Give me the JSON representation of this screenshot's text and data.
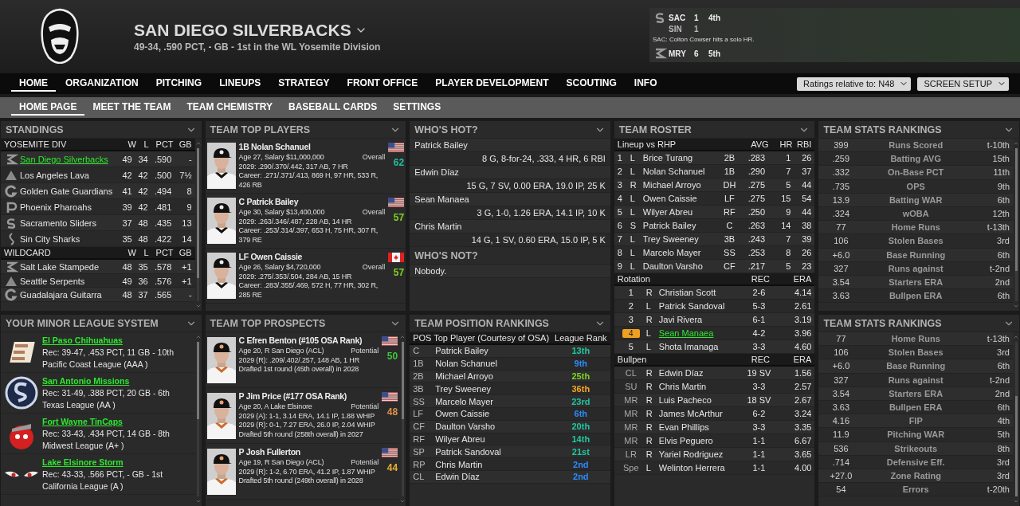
{
  "header": {
    "team_name": "SAN DIEGO SILVERBACKS",
    "record": "49-34, .590 PCT, - GB - 1st in the WL Yosemite Division"
  },
  "scoreboard": [
    {
      "away": "SAC",
      "away_score": "1",
      "inning": "4th",
      "home": "SIN",
      "home_score": "1",
      "note": "SAC: Colton Cowser hits a solo HR."
    },
    {
      "away": "MRY",
      "away_score": "6",
      "inning": "5th"
    }
  ],
  "nav": {
    "tabs": [
      {
        "label": "HOME",
        "selected": true
      },
      {
        "label": "ORGANIZATION",
        "selected": false
      },
      {
        "label": "PITCHING",
        "selected": false
      },
      {
        "label": "LINEUPS",
        "selected": false
      },
      {
        "label": "STRATEGY",
        "selected": false
      },
      {
        "label": "FRONT OFFICE",
        "selected": false
      },
      {
        "label": "PLAYER DEVELOPMENT",
        "selected": false
      },
      {
        "label": "SCOUTING",
        "selected": false
      },
      {
        "label": "INFO",
        "selected": false
      }
    ],
    "dropdowns": [
      "Ratings relative to: N48",
      "SCREEN SETUP"
    ]
  },
  "subnav": [
    {
      "label": "HOME PAGE",
      "selected": true
    },
    {
      "label": "MEET THE TEAM",
      "selected": false
    },
    {
      "label": "TEAM CHEMISTRY",
      "selected": false
    },
    {
      "label": "BASEBALL CARDS",
      "selected": false
    },
    {
      "label": "SETTINGS",
      "selected": false
    }
  ],
  "standings": {
    "title": "STANDINGS",
    "groups": [
      {
        "name": "YOSEMITE DIV",
        "columns": [
          "W",
          "L",
          "PCT",
          "GB"
        ],
        "rows": [
          {
            "team": "San Diego Silverbacks",
            "w": "49",
            "l": "34",
            "pct": ".590",
            "gb": "-",
            "selected": true
          },
          {
            "team": "Los Angeles Lava",
            "w": "42",
            "l": "42",
            "pct": ".500",
            "gb": "7½",
            "selected": false
          },
          {
            "team": "Golden Gate Guardians",
            "w": "41",
            "l": "42",
            "pct": ".494",
            "gb": "8",
            "selected": false
          },
          {
            "team": "Phoenix Pharoahs",
            "w": "39",
            "l": "42",
            "pct": ".481",
            "gb": "9",
            "selected": false
          },
          {
            "team": "Sacramento Sliders",
            "w": "37",
            "l": "48",
            "pct": ".435",
            "gb": "13",
            "selected": false
          },
          {
            "team": "Sin City Sharks",
            "w": "35",
            "l": "48",
            "pct": ".422",
            "gb": "14",
            "selected": false
          }
        ]
      },
      {
        "name": "WILDCARD",
        "columns": [
          "W",
          "L",
          "PCT",
          "GB"
        ],
        "rows": [
          {
            "team": "Salt Lake Stampede",
            "w": "48",
            "l": "35",
            "pct": ".578",
            "gb": "+1",
            "selected": false
          },
          {
            "team": "Seattle Serpents",
            "w": "49",
            "l": "36",
            "pct": ".576",
            "gb": "+1",
            "selected": false
          },
          {
            "team": "Guadalajara Guitarra",
            "w": "48",
            "l": "37",
            "pct": ".565",
            "gb": "-",
            "selected": false
          }
        ]
      }
    ]
  },
  "top_players": {
    "title": "TEAM TOP PLAYERS",
    "players": [
      {
        "name": "1B Nolan Schanuel",
        "kind": "us",
        "info": "Age 27, Salary $11,000,000",
        "rating_label": "Overall",
        "rating": "62",
        "color": "#1fbfa0",
        "season": "2029: .290/.370/.442, 317 AB, 7 HR",
        "career": "Career: .271/.371/.413, 869 H, 97 HR, 533 R, 426 RB"
      },
      {
        "name": "C Patrick Bailey",
        "kind": "us",
        "info": "Age 30, Salary $13,400,000",
        "rating_label": "Overall",
        "rating": "57",
        "color": "#7ed321",
        "season": "2029: .263/.346/.487, 228 AB, 14 HR",
        "career": "Career: .253/.314/.397, 653 H, 75 HR, 307 R, 379 RE"
      },
      {
        "name": "LF Owen Caissie",
        "kind": "ca",
        "info": "Age 26, Salary $4,720,000",
        "rating_label": "Overall",
        "rating": "57",
        "color": "#7ed321",
        "season": "2029: .275/.353/.504, 284 AB, 15 HR",
        "career": "Career: .283/.355/.469, 572 H, 77 HR, 302 R, 285 RE"
      }
    ]
  },
  "whos_hot": {
    "title": "WHO'S HOT?",
    "players": [
      {
        "name": "Patrick Bailey",
        "line": "8 G, 8-for-24, .333, 4 HR, 6 RBI"
      },
      {
        "name": "Edwin Díaz",
        "line": "15 G, 7 SV, 0.00 ERA, 19.0 IP, 25 K"
      },
      {
        "name": "Sean Manaea",
        "line": "3 G, 1-0, 1.26 ERA, 14.1 IP, 10 K"
      },
      {
        "name": "Chris Martin",
        "line": "14 G, 1 SV, 0.60 ERA, 15.0 IP, 5 K"
      }
    ],
    "not_title": "WHO'S NOT?",
    "not_text": "Nobody."
  },
  "roster": {
    "title": "TEAM ROSTER",
    "lineup": {
      "label": "Lineup vs RHP",
      "columns": [
        "AVG",
        "HR",
        "RBI"
      ],
      "rows": [
        {
          "order": "1",
          "bats": "L",
          "name": "Brice Turang",
          "pos": "2B",
          "avg": ".283",
          "hr": "1",
          "rbi": "26"
        },
        {
          "order": "2",
          "bats": "L",
          "name": "Nolan Schanuel",
          "pos": "1B",
          "avg": ".290",
          "hr": "7",
          "rbi": "37"
        },
        {
          "order": "3",
          "bats": "R",
          "name": "Michael Arroyo",
          "pos": "DH",
          "avg": ".275",
          "hr": "5",
          "rbi": "44"
        },
        {
          "order": "4",
          "bats": "L",
          "name": "Owen Caissie",
          "pos": "LF",
          "avg": ".275",
          "hr": "15",
          "rbi": "54"
        },
        {
          "order": "5",
          "bats": "L",
          "name": "Wilyer Abreu",
          "pos": "RF",
          "avg": ".250",
          "hr": "9",
          "rbi": "44"
        },
        {
          "order": "6",
          "bats": "S",
          "name": "Patrick Bailey",
          "pos": "C",
          "avg": ".263",
          "hr": "14",
          "rbi": "38"
        },
        {
          "order": "7",
          "bats": "L",
          "name": "Trey Sweeney",
          "pos": "3B",
          "avg": ".243",
          "hr": "7",
          "rbi": "39"
        },
        {
          "order": "8",
          "bats": "L",
          "name": "Marcelo Mayer",
          "pos": "SS",
          "avg": ".253",
          "hr": "8",
          "rbi": "26"
        },
        {
          "order": "9",
          "bats": "L",
          "name": "Daulton Varsho",
          "pos": "CF",
          "avg": ".217",
          "hr": "5",
          "rbi": "23"
        }
      ]
    },
    "rotation": {
      "label": "Rotation",
      "columns": [
        "REC",
        "ERA"
      ],
      "rows": [
        {
          "order": "1",
          "throws": "R",
          "name": "Christian Scott",
          "rec": "2-6",
          "era": "4.14",
          "selected": false
        },
        {
          "order": "2",
          "throws": "L",
          "name": "Patrick Sandoval",
          "rec": "5-3",
          "era": "2.61",
          "selected": false
        },
        {
          "order": "3",
          "throws": "R",
          "name": "Javi Rivera",
          "rec": "6-1",
          "era": "3.19",
          "selected": false
        },
        {
          "order": "4",
          "throws": "L",
          "name": "Sean Manaea",
          "rec": "4-2",
          "era": "3.96",
          "selected": true
        },
        {
          "order": "5",
          "throws": "L",
          "name": "Shota Imanaga",
          "rec": "3-3",
          "era": "4.60",
          "selected": false
        }
      ]
    },
    "bullpen": {
      "label": "Bullpen",
      "columns": [
        "REC",
        "ERA"
      ],
      "rows": [
        {
          "role": "CL",
          "throws": "R",
          "name": "Edwin Díaz",
          "rec": "19 SV",
          "era": "1.56"
        },
        {
          "role": "SU",
          "throws": "R",
          "name": "Chris Martin",
          "rec": "3-3",
          "era": "2.57"
        },
        {
          "role": "MR",
          "throws": "R",
          "name": "Luis Pacheco",
          "rec": "18 SV",
          "era": "2.67"
        },
        {
          "role": "MR",
          "throws": "R",
          "name": "James McArthur",
          "rec": "6-2",
          "era": "3.24"
        },
        {
          "role": "MR",
          "throws": "R",
          "name": "Evan Phillips",
          "rec": "3-3",
          "era": "3.35"
        },
        {
          "role": "MR",
          "throws": "R",
          "name": "Elvis Peguero",
          "rec": "1-1",
          "era": "6.67"
        },
        {
          "role": "LR",
          "throws": "R",
          "name": "Yariel Rodriguez",
          "rec": "1-1",
          "era": "3.65"
        },
        {
          "role": "Spe",
          "throws": "L",
          "name": "Welinton Herrera",
          "rec": "1-1",
          "era": "4.00"
        }
      ]
    }
  },
  "stats_rankings": [
    {
      "title": "TEAM STATS RANKINGS",
      "rows": [
        {
          "value": "399",
          "stat": "Runs Scored",
          "rank": "t-10th"
        },
        {
          "value": ".259",
          "stat": "Batting AVG",
          "rank": "15th"
        },
        {
          "value": ".332",
          "stat": "On-Base PCT",
          "rank": "11th"
        },
        {
          "value": ".735",
          "stat": "OPS",
          "rank": "9th"
        },
        {
          "value": "13.9",
          "stat": "Batting WAR",
          "rank": "6th"
        },
        {
          "value": ".324",
          "stat": "wOBA",
          "rank": "12th"
        },
        {
          "value": "77",
          "stat": "Home Runs",
          "rank": "t-13th"
        },
        {
          "value": "106",
          "stat": "Stolen Bases",
          "rank": "3rd"
        },
        {
          "value": "+6.0",
          "stat": "Base Running",
          "rank": "6th"
        },
        {
          "value": "327",
          "stat": "Runs against",
          "rank": "t-2nd"
        },
        {
          "value": "3.54",
          "stat": "Starters ERA",
          "rank": "2nd"
        },
        {
          "value": "3.63",
          "stat": "Bullpen ERA",
          "rank": "6th"
        }
      ]
    },
    {
      "title": "TEAM STATS RANKINGS",
      "rows": [
        {
          "value": "77",
          "stat": "Home Runs",
          "rank": "t-13th"
        },
        {
          "value": "106",
          "stat": "Stolen Bases",
          "rank": "3rd"
        },
        {
          "value": "+6.0",
          "stat": "Base Running",
          "rank": "6th"
        },
        {
          "value": "327",
          "stat": "Runs against",
          "rank": "t-2nd"
        },
        {
          "value": "3.54",
          "stat": "Starters ERA",
          "rank": "2nd"
        },
        {
          "value": "3.63",
          "stat": "Bullpen ERA",
          "rank": "6th"
        },
        {
          "value": "4.16",
          "stat": "FIP",
          "rank": "4th"
        },
        {
          "value": "11.9",
          "stat": "Pitching WAR",
          "rank": "5th"
        },
        {
          "value": "536",
          "stat": "Strikeouts",
          "rank": "8th"
        },
        {
          "value": ".714",
          "stat": "Defensive Eff.",
          "rank": "3rd"
        },
        {
          "value": "+27.0",
          "stat": "Zone Rating",
          "rank": "3rd"
        },
        {
          "value": "54",
          "stat": "Errors",
          "rank": "t-20th"
        }
      ]
    }
  ],
  "minor_leagues": {
    "title": "YOUR MINOR LEAGUE SYSTEM",
    "teams": [
      {
        "name": "El Paso Chihuahuas",
        "record": "Rec: 39-47, .453 PCT, 11 GB - 10th",
        "league": "Pacific Coast League (AAA )"
      },
      {
        "name": "San Antonio Missions",
        "record": "Rec: 31-49, .388 PCT, 20 GB - 6th",
        "league": "Texas League (AA )"
      },
      {
        "name": "Fort Wayne TinCaps",
        "record": "Rec: 33-43, .434 PCT, 14 GB - 8th",
        "league": "Midwest League (A+ )"
      },
      {
        "name": "Lake Elsinore Storm",
        "record": "Rec: 43-33, .566 PCT, - GB - 1st",
        "league": "California League (A )"
      }
    ]
  },
  "top_prospects": {
    "title": "TEAM TOP PROSPECTS",
    "players": [
      {
        "name": "C Efren Benton (#105 OSA Rank)",
        "kind": "us",
        "info": "Age 20, R San Diego (ACL)",
        "rating_label": "Potential",
        "rating": "50",
        "color": "#3ec43e",
        "stats": [
          "2029 (R): .209/.402/.257, 148 AB, 1 HR"
        ],
        "drafted": "Drafted 1st round (45th overall) in 2028"
      },
      {
        "name": "P Jim Price (#177 OSA Rank)",
        "kind": "us",
        "info": "Age 20, A Lake Elsinore",
        "rating_label": "Potential",
        "rating": "48",
        "color": "#e0904a",
        "stats": [
          "2029 (A): 1-1, 3.14 ERA, 14.1 IP, 1.88 WHIP",
          "2029 (R): 0-1, 7.27 ERA, 26.0 IP, 2.04 WHIP"
        ],
        "drafted": "Drafted 5th round (258th overall) in 2027"
      },
      {
        "name": "P Josh Fullerton",
        "kind": "us",
        "info": "Age 19, R San Diego (ACL)",
        "rating_label": "Potential",
        "rating": "44",
        "color": "#e8b030",
        "stats": [
          "2029 (R): 1-2, 6.70 ERA, 41.2 IP, 1.87 WHIP"
        ],
        "drafted": "Drafted 5th round (249th overall) in 2028"
      }
    ]
  },
  "position_rankings": {
    "title": "TEAM POSITION RANKINGS",
    "columns": [
      "POS",
      "Top Player (Courtesy of OSA)",
      "League Rank"
    ],
    "rows": [
      {
        "pos": "C",
        "player": "Patrick Bailey",
        "rank": "13th",
        "color": "#1ec8a0"
      },
      {
        "pos": "1B",
        "player": "Nolan Schanuel",
        "rank": "9th",
        "color": "#2a8cff"
      },
      {
        "pos": "2B",
        "player": "Michael Arroyo",
        "rank": "25th",
        "color": "#7ed321"
      },
      {
        "pos": "3B",
        "player": "Trey Sweeney",
        "rank": "36th",
        "color": "#f5a623"
      },
      {
        "pos": "SS",
        "player": "Marcelo Mayer",
        "rank": "23rd",
        "color": "#1ec8a0"
      },
      {
        "pos": "LF",
        "player": "Owen Caissie",
        "rank": "6th",
        "color": "#2a8cff"
      },
      {
        "pos": "CF",
        "player": "Daulton Varsho",
        "rank": "20th",
        "color": "#1ec8a0"
      },
      {
        "pos": "RF",
        "player": "Wilyer Abreu",
        "rank": "14th",
        "color": "#1ec8a0"
      },
      {
        "pos": "SP",
        "player": "Patrick Sandoval",
        "rank": "21st",
        "color": "#1ec8a0"
      },
      {
        "pos": "RP",
        "player": "Chris Martin",
        "rank": "2nd",
        "color": "#2a8cff"
      },
      {
        "pos": "CL",
        "player": "Edwin Díaz",
        "rank": "2nd",
        "color": "#2a8cff"
      }
    ]
  }
}
